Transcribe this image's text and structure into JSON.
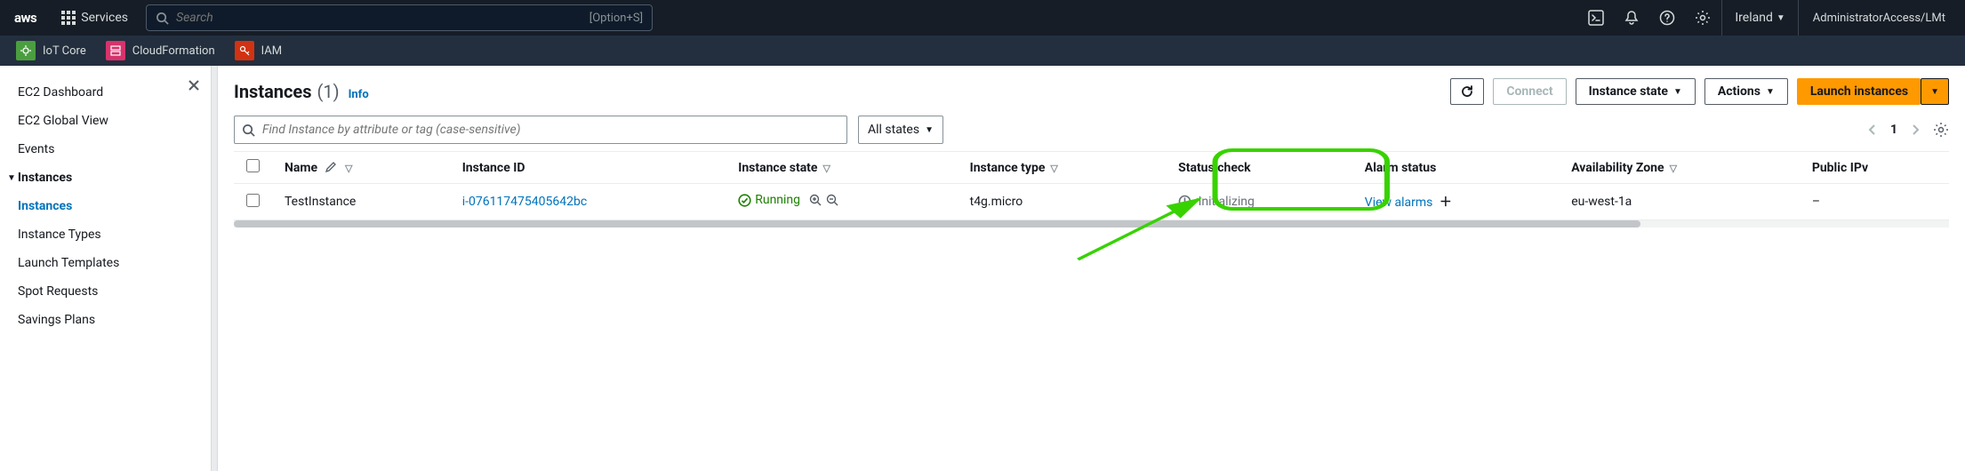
{
  "topnav": {
    "logo": "aws",
    "services": "Services",
    "search_placeholder": "Search",
    "search_hint": "[Option+S]",
    "region": "Ireland",
    "account": "AdministratorAccess/LMt"
  },
  "servicebar": {
    "items": [
      {
        "label": "IoT Core",
        "color": "green"
      },
      {
        "label": "CloudFormation",
        "color": "pink"
      },
      {
        "label": "IAM",
        "color": "red"
      }
    ]
  },
  "sidebar": {
    "items": [
      {
        "label": "EC2 Dashboard"
      },
      {
        "label": "EC2 Global View"
      },
      {
        "label": "Events"
      }
    ],
    "group": "Instances",
    "sub": [
      {
        "label": "Instances",
        "active": true
      },
      {
        "label": "Instance Types"
      },
      {
        "label": "Launch Templates"
      },
      {
        "label": "Spot Requests"
      },
      {
        "label": "Savings Plans"
      }
    ]
  },
  "page": {
    "title": "Instances",
    "count": "(1)",
    "info": "Info",
    "actions": {
      "connect": "Connect",
      "instance_state": "Instance state",
      "actions": "Actions",
      "launch": "Launch instances"
    },
    "filter_placeholder": "Find Instance by attribute or tag (case-sensitive)",
    "states": "All states",
    "page_num": "1"
  },
  "table": {
    "cols": {
      "name": "Name",
      "instance_id": "Instance ID",
      "instance_state": "Instance state",
      "instance_type": "Instance type",
      "status_check": "Status check",
      "alarm_status": "Alarm status",
      "az": "Availability Zone",
      "public_ip": "Public IPv"
    },
    "rows": [
      {
        "name": "TestInstance",
        "instance_id": "i-076117475405642bc",
        "instance_state": "Running",
        "instance_type": "t4g.micro",
        "status_check": "Initializing",
        "alarm_status": "View alarms",
        "az": "eu-west-1a",
        "public_ip": "–"
      }
    ]
  }
}
